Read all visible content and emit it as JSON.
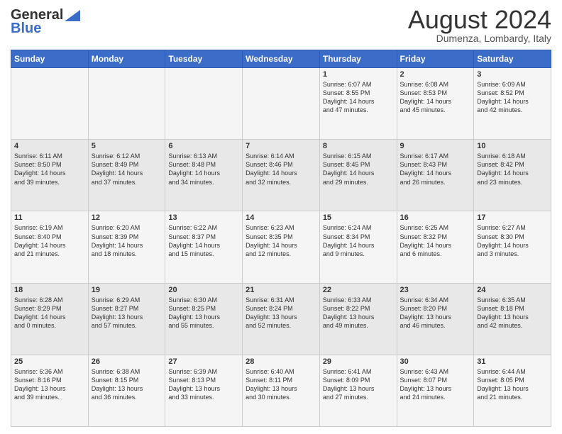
{
  "header": {
    "logo_general": "General",
    "logo_blue": "Blue",
    "month_title": "August 2024",
    "location": "Dumenza, Lombardy, Italy"
  },
  "days_of_week": [
    "Sunday",
    "Monday",
    "Tuesday",
    "Wednesday",
    "Thursday",
    "Friday",
    "Saturday"
  ],
  "weeks": [
    [
      {
        "day": "",
        "info": ""
      },
      {
        "day": "",
        "info": ""
      },
      {
        "day": "",
        "info": ""
      },
      {
        "day": "",
        "info": ""
      },
      {
        "day": "1",
        "info": "Sunrise: 6:07 AM\nSunset: 8:55 PM\nDaylight: 14 hours\nand 47 minutes."
      },
      {
        "day": "2",
        "info": "Sunrise: 6:08 AM\nSunset: 8:53 PM\nDaylight: 14 hours\nand 45 minutes."
      },
      {
        "day": "3",
        "info": "Sunrise: 6:09 AM\nSunset: 8:52 PM\nDaylight: 14 hours\nand 42 minutes."
      }
    ],
    [
      {
        "day": "4",
        "info": "Sunrise: 6:11 AM\nSunset: 8:50 PM\nDaylight: 14 hours\nand 39 minutes."
      },
      {
        "day": "5",
        "info": "Sunrise: 6:12 AM\nSunset: 8:49 PM\nDaylight: 14 hours\nand 37 minutes."
      },
      {
        "day": "6",
        "info": "Sunrise: 6:13 AM\nSunset: 8:48 PM\nDaylight: 14 hours\nand 34 minutes."
      },
      {
        "day": "7",
        "info": "Sunrise: 6:14 AM\nSunset: 8:46 PM\nDaylight: 14 hours\nand 32 minutes."
      },
      {
        "day": "8",
        "info": "Sunrise: 6:15 AM\nSunset: 8:45 PM\nDaylight: 14 hours\nand 29 minutes."
      },
      {
        "day": "9",
        "info": "Sunrise: 6:17 AM\nSunset: 8:43 PM\nDaylight: 14 hours\nand 26 minutes."
      },
      {
        "day": "10",
        "info": "Sunrise: 6:18 AM\nSunset: 8:42 PM\nDaylight: 14 hours\nand 23 minutes."
      }
    ],
    [
      {
        "day": "11",
        "info": "Sunrise: 6:19 AM\nSunset: 8:40 PM\nDaylight: 14 hours\nand 21 minutes."
      },
      {
        "day": "12",
        "info": "Sunrise: 6:20 AM\nSunset: 8:39 PM\nDaylight: 14 hours\nand 18 minutes."
      },
      {
        "day": "13",
        "info": "Sunrise: 6:22 AM\nSunset: 8:37 PM\nDaylight: 14 hours\nand 15 minutes."
      },
      {
        "day": "14",
        "info": "Sunrise: 6:23 AM\nSunset: 8:35 PM\nDaylight: 14 hours\nand 12 minutes."
      },
      {
        "day": "15",
        "info": "Sunrise: 6:24 AM\nSunset: 8:34 PM\nDaylight: 14 hours\nand 9 minutes."
      },
      {
        "day": "16",
        "info": "Sunrise: 6:25 AM\nSunset: 8:32 PM\nDaylight: 14 hours\nand 6 minutes."
      },
      {
        "day": "17",
        "info": "Sunrise: 6:27 AM\nSunset: 8:30 PM\nDaylight: 14 hours\nand 3 minutes."
      }
    ],
    [
      {
        "day": "18",
        "info": "Sunrise: 6:28 AM\nSunset: 8:29 PM\nDaylight: 14 hours\nand 0 minutes."
      },
      {
        "day": "19",
        "info": "Sunrise: 6:29 AM\nSunset: 8:27 PM\nDaylight: 13 hours\nand 57 minutes."
      },
      {
        "day": "20",
        "info": "Sunrise: 6:30 AM\nSunset: 8:25 PM\nDaylight: 13 hours\nand 55 minutes."
      },
      {
        "day": "21",
        "info": "Sunrise: 6:31 AM\nSunset: 8:24 PM\nDaylight: 13 hours\nand 52 minutes."
      },
      {
        "day": "22",
        "info": "Sunrise: 6:33 AM\nSunset: 8:22 PM\nDaylight: 13 hours\nand 49 minutes."
      },
      {
        "day": "23",
        "info": "Sunrise: 6:34 AM\nSunset: 8:20 PM\nDaylight: 13 hours\nand 46 minutes."
      },
      {
        "day": "24",
        "info": "Sunrise: 6:35 AM\nSunset: 8:18 PM\nDaylight: 13 hours\nand 42 minutes."
      }
    ],
    [
      {
        "day": "25",
        "info": "Sunrise: 6:36 AM\nSunset: 8:16 PM\nDaylight: 13 hours\nand 39 minutes."
      },
      {
        "day": "26",
        "info": "Sunrise: 6:38 AM\nSunset: 8:15 PM\nDaylight: 13 hours\nand 36 minutes."
      },
      {
        "day": "27",
        "info": "Sunrise: 6:39 AM\nSunset: 8:13 PM\nDaylight: 13 hours\nand 33 minutes."
      },
      {
        "day": "28",
        "info": "Sunrise: 6:40 AM\nSunset: 8:11 PM\nDaylight: 13 hours\nand 30 minutes."
      },
      {
        "day": "29",
        "info": "Sunrise: 6:41 AM\nSunset: 8:09 PM\nDaylight: 13 hours\nand 27 minutes."
      },
      {
        "day": "30",
        "info": "Sunrise: 6:43 AM\nSunset: 8:07 PM\nDaylight: 13 hours\nand 24 minutes."
      },
      {
        "day": "31",
        "info": "Sunrise: 6:44 AM\nSunset: 8:05 PM\nDaylight: 13 hours\nand 21 minutes."
      }
    ]
  ]
}
